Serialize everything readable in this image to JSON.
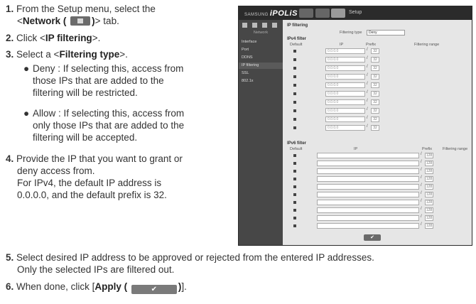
{
  "steps": {
    "s1_num": "1.",
    "s1_a": "From the Setup menu, select the",
    "s1_b_pre": "<",
    "s1_b_bold": "Network (",
    "s1_b_bold2": ")",
    "s1_b_post": "> tab.",
    "s2_num": "2.",
    "s2_pre": "Click <",
    "s2_bold": "IP filtering",
    "s2_post": ">.",
    "s3_num": "3.",
    "s3_pre": "Select a <",
    "s3_bold": "Filtering type",
    "s3_post": ">.",
    "deny_1": "Deny : If selecting this, access from",
    "deny_2": "those IPs that are added to the",
    "deny_3": "filtering will be restricted.",
    "allow_1": "Allow : If selecting this, access from",
    "allow_2": "only those IPs that are added to the",
    "allow_3": "filtering will be accepted.",
    "s4_num": "4.",
    "s4_1": "Provide the IP that you want to grant or",
    "s4_2": "deny access from.",
    "s4_3": "For IPv4, the default IP address is",
    "s4_4": "0.0.0.0, and the default prefix is 32.",
    "s5_num": "5.",
    "s5_1": "Select desired IP address to be approved or rejected from the entered IP addresses.",
    "s5_2": "Only the selected IPs are filtered out.",
    "s6_num": "6.",
    "s6_pre": "When done, click [",
    "s6_bold": "Apply (",
    "s6_bold2": ")",
    "s6_post": "]."
  },
  "screenshot": {
    "brand_small": "SAMSUNG",
    "brand_big": "iPOLiS",
    "setup_label": "Setup",
    "side_sub": "Network",
    "menu": [
      "Interface",
      "Port",
      "DDNS",
      "IP filtering",
      "SSL",
      "802.1x"
    ],
    "title": "IP filtering",
    "filtering_type_label": "Filtering type",
    "filtering_type_value": "Deny",
    "ipv4_title": "IPv4 filter",
    "ipv4_cols": [
      "Default",
      "IP",
      "Prefix",
      "Filtering range"
    ],
    "ipv6_title": "IPv6 filter",
    "ipv6_cols": [
      "Default",
      "IP",
      "Prefix",
      "Filtering range"
    ],
    "ipv4_ip": "0.0.0.0",
    "ipv4_prefix": "32",
    "ipv6_prefix": "128",
    "apply_icon": "check-icon"
  }
}
